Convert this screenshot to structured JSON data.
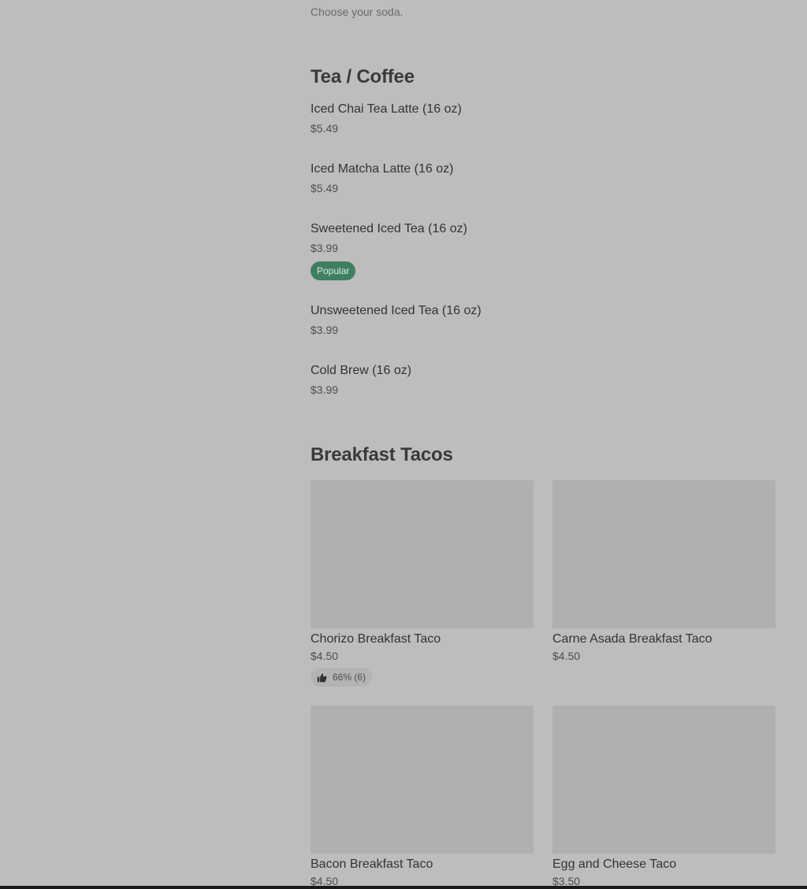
{
  "previous_section": {
    "description": "Choose your soda."
  },
  "tea_coffee": {
    "title": "Tea / Coffee",
    "items": [
      {
        "name": "Iced Chai Tea Latte (16 oz)",
        "price": "$5.49"
      },
      {
        "name": "Iced Matcha Latte (16 oz)",
        "price": "$5.49"
      },
      {
        "name": "Sweetened Iced Tea (16 oz)",
        "price": "$3.99",
        "badge": "Popular"
      },
      {
        "name": "Unsweetened Iced Tea (16 oz)",
        "price": "$3.99"
      },
      {
        "name": "Cold Brew (16 oz)",
        "price": "$3.99"
      }
    ]
  },
  "breakfast_tacos": {
    "title": "Breakfast Tacos",
    "items": [
      {
        "name": "Chorizo Breakfast Taco",
        "price": "$4.50",
        "rating": "66% (6)"
      },
      {
        "name": "Carne Asada Breakfast Taco",
        "price": "$4.50"
      },
      {
        "name": "Bacon Breakfast Taco",
        "price": "$4.50"
      },
      {
        "name": "Egg and Cheese Taco",
        "price": "$3.50"
      }
    ]
  },
  "colors": {
    "background": "#bdbdbd",
    "popular_badge": "#3f7f5f",
    "image_placeholder": "#b0b0b0"
  },
  "icons": {
    "rating": "thumbs-up-icon"
  }
}
